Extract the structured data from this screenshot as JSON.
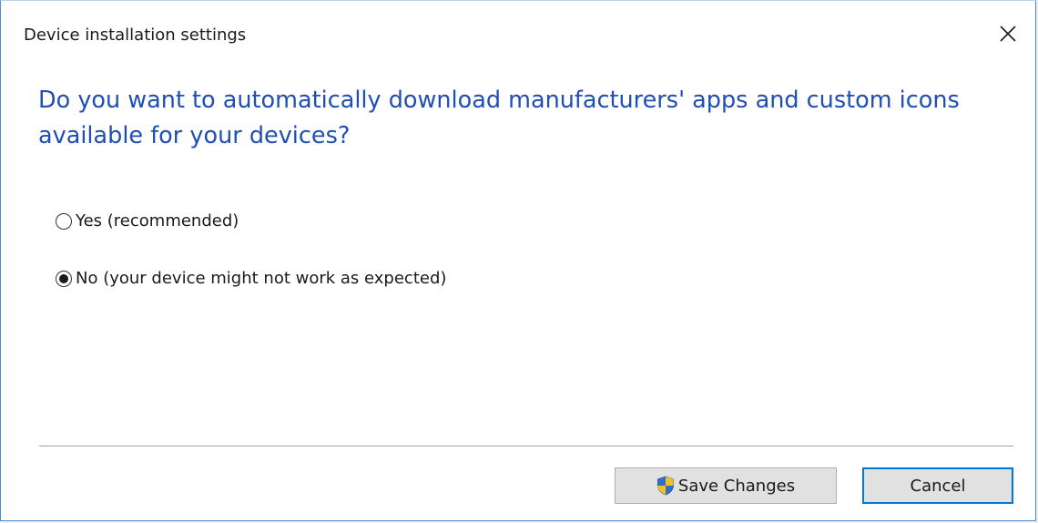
{
  "dialog": {
    "title": "Device installation settings",
    "heading": "Do you want to automatically download manufacturers' apps and custom icons available for your devices?",
    "options": [
      {
        "label": "Yes (recommended)",
        "selected": false
      },
      {
        "label": "No (your device might not work as expected)",
        "selected": true
      }
    ],
    "buttons": {
      "save_label": "Save Changes",
      "cancel_label": "Cancel"
    }
  },
  "icons": {
    "close": "close-icon",
    "shield": "uac-shield-icon"
  },
  "colors": {
    "heading": "#1f4fb4",
    "accent_border": "#0078d7",
    "button_bg": "#e1e1e1"
  }
}
